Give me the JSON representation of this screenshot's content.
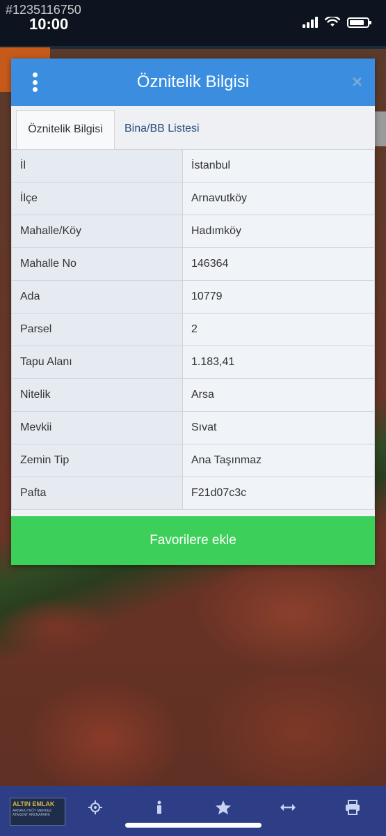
{
  "watermark_id": "#1235116750",
  "status_bar": {
    "time": "10:00"
  },
  "dialog": {
    "title": "Öznitelik Bilgisi",
    "close_label": "×",
    "tabs": [
      {
        "label": "Öznitelik Bilgisi",
        "active": true
      },
      {
        "label": "Bina/BB Listesi",
        "active": false
      }
    ],
    "rows": [
      {
        "key": "İl",
        "value": "İstanbul"
      },
      {
        "key": "İlçe",
        "value": "Arnavutköy"
      },
      {
        "key": "Mahalle/Köy",
        "value": "Hadımköy"
      },
      {
        "key": "Mahalle No",
        "value": "146364"
      },
      {
        "key": "Ada",
        "value": "10779"
      },
      {
        "key": "Parsel",
        "value": "2"
      },
      {
        "key": "Tapu Alanı",
        "value": "1.183,41"
      },
      {
        "key": "Nitelik",
        "value": "Arsa"
      },
      {
        "key": "Mevkii",
        "value": "Sıvat"
      },
      {
        "key": "Zemin Tip",
        "value": "Ana Taşınmaz"
      },
      {
        "key": "Pafta",
        "value": "F21d07c3c"
      }
    ],
    "favorite_button": "Favorilere ekle"
  },
  "bottom_bar": {
    "logo_text": "ALTIN EMLAK",
    "logo_subtext": "ARNAVUTKÖY MERKEZ ATAKENT ARENAPARK",
    "icons": [
      "locate-icon",
      "info-icon",
      "star-icon",
      "measure-icon",
      "print-icon"
    ]
  },
  "colors": {
    "header": "#3b8de0",
    "favorite_button": "#3ccf5a",
    "bottom_bar": "#2d3e86"
  }
}
